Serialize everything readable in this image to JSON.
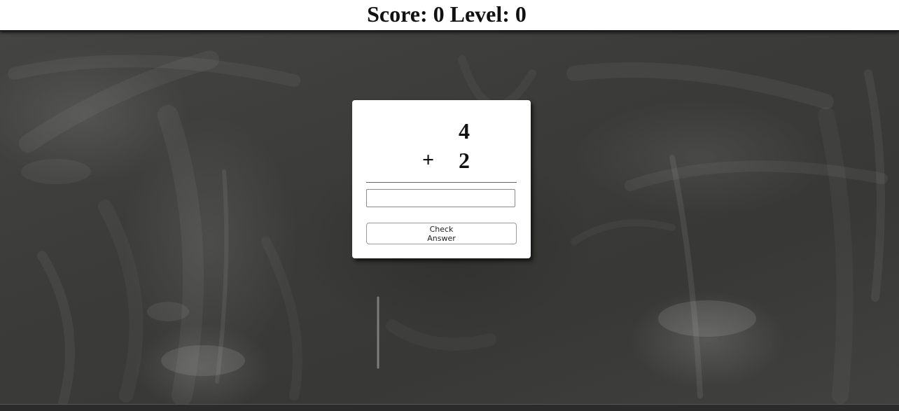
{
  "header": {
    "score_label": "Score:",
    "score_value": "0",
    "level_label": "Level:",
    "level_value": "0"
  },
  "problem": {
    "top_operand": "4",
    "operator": "+",
    "bottom_operand": "2"
  },
  "answer": {
    "value": "",
    "placeholder": ""
  },
  "check_button": {
    "label": "Check Answer"
  },
  "colors": {
    "board": "#3b3b39",
    "card": "#ffffff",
    "topbar": "#ffffff"
  }
}
